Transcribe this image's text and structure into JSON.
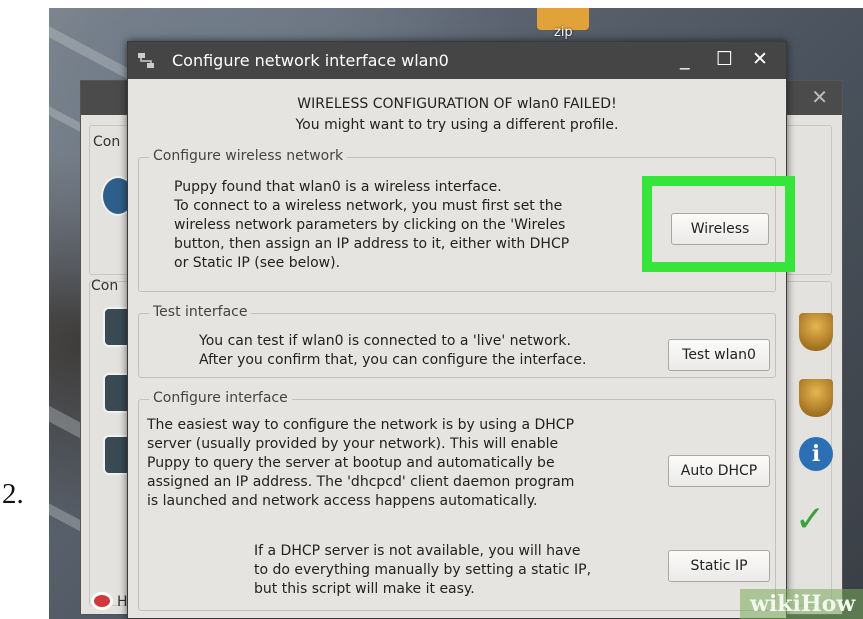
{
  "step_number": "2.",
  "desktop": {
    "zip_label": "zip"
  },
  "background_window": {
    "labels": [
      "Con",
      "Con"
    ],
    "help_label": "H"
  },
  "dialog": {
    "title": "Configure network interface wlan0",
    "controls": {
      "minimize": "_",
      "maximize": "☐",
      "close": "✕"
    },
    "failure_line1": "WIRELESS CONFIGURATION OF wlan0 FAILED!",
    "failure_line2": "You might want to try using a different profile.",
    "wireless_group": {
      "legend": "Configure wireless network",
      "lines": [
        "Puppy found that wlan0 is a wireless interface.",
        "To connect to a wireless network, you must first set the",
        "wireless network parameters by clicking on the 'Wireles",
        "button, then assign an IP address to it, either with DHCP",
        "or Static IP (see below)."
      ],
      "button": "Wireless"
    },
    "test_group": {
      "legend": "Test interface",
      "lines": [
        "You can test if wlan0 is connected to a 'live' network.",
        "After you confirm that, you can configure the interface."
      ],
      "button": "Test wlan0"
    },
    "configure_group": {
      "legend": "Configure interface",
      "lines": [
        "The easiest way to configure the network is by using a DHCP",
        "server (usually provided by your network). This will enable",
        "Puppy to query the server at bootup and automatically be",
        "assigned an IP address. The 'dhcpcd' client daemon program",
        "is launched and network access happens automatically."
      ],
      "dhcp_button": "Auto DHCP",
      "static_lines": [
        "If a DHCP server is not available, you will have",
        "to do everything manually by setting a static IP,",
        "but this script will make it easy."
      ],
      "static_button": "Static IP"
    }
  },
  "watermark": "wikiHow",
  "colors": {
    "highlight": "#35e53a",
    "titlebar": "#454545",
    "dialog_bg": "#e6e4e1"
  }
}
